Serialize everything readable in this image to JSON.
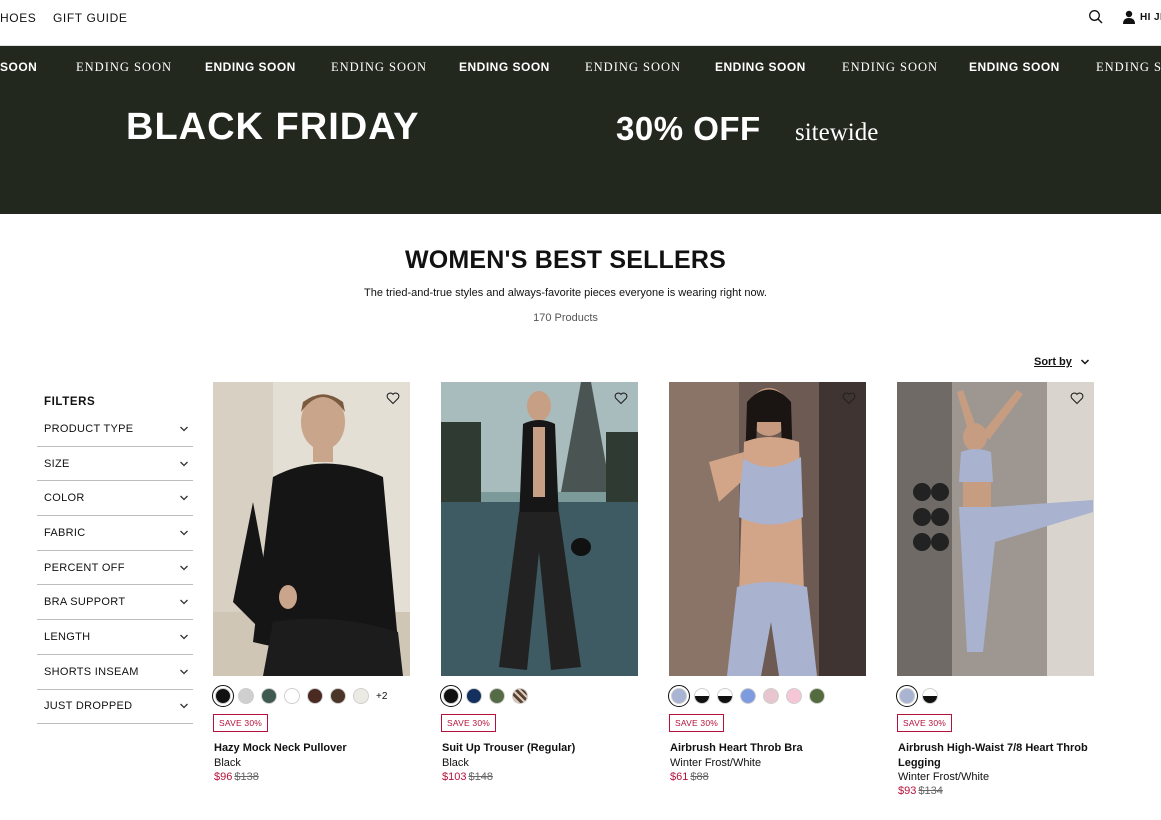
{
  "nav": {
    "shoes": "HOES",
    "gift_guide": "GIFT GUIDE",
    "account": "HI JE"
  },
  "banner": {
    "ticker": [
      "SOON",
      "ENDING SOON",
      "ENDING SOON",
      "ENDING SOON",
      "ENDING SOON",
      "ENDING SOON",
      "ENDING SOON",
      "ENDING SOON",
      "ENDING SOON",
      "ENDING SOON"
    ],
    "headline": "BLACK FRIDAY",
    "offer": "30% OFF",
    "offer_suffix": "sitewide",
    "background": "#23281f"
  },
  "page": {
    "title": "WOMEN'S BEST SELLERS",
    "subtitle": "The tried-and-true styles and always-favorite pieces everyone is wearing right now.",
    "count": "170 Products",
    "sort_label": "Sort by"
  },
  "filters": {
    "title": "FILTERS",
    "items": [
      "PRODUCT TYPE",
      "SIZE",
      "COLOR",
      "FABRIC",
      "PERCENT OFF",
      "BRA SUPPORT",
      "LENGTH",
      "SHORTS INSEAM",
      "JUST DROPPED"
    ]
  },
  "products": [
    {
      "name": "Hazy Mock Neck Pullover",
      "color": "Black",
      "price": "$96",
      "was": "$138",
      "badge": "SAVE 30%",
      "more": "+2",
      "swatches": [
        "#111111",
        "#cfcfcf",
        "#3f5a50",
        "#ffffff",
        "#4a2a22",
        "#4b3527",
        "#ecebe3"
      ]
    },
    {
      "name": "Suit Up Trouser (Regular)",
      "color": "Black",
      "price": "$103",
      "was": "$148",
      "badge": "SAVE 30%",
      "more": "",
      "swatches": [
        "#111111",
        "#14305e",
        "#556b45",
        "pinstripe"
      ]
    },
    {
      "name": "Airbrush Heart Throb Bra",
      "color": "Winter Frost/White",
      "price": "$61",
      "was": "$88",
      "badge": "SAVE 30%",
      "more": "",
      "swatches": [
        "#a9b4d2",
        "split",
        "split",
        "#7f9be0",
        "#e8c6cf",
        "#f5c7d6",
        "#536b3e"
      ]
    },
    {
      "name": "Airbrush High-Waist 7/8 Heart Throb Legging",
      "color": "Winter Frost/White",
      "price": "$93",
      "was": "$134",
      "badge": "SAVE 30%",
      "more": "",
      "swatches": [
        "#a9b4d2",
        "split"
      ]
    }
  ],
  "colors": {
    "sale": "#b5123b",
    "banner": "#23281f"
  }
}
